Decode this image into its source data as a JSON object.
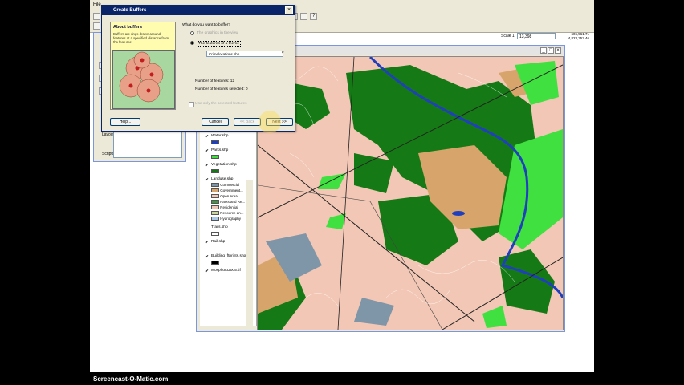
{
  "app": {
    "menu_file": "File"
  },
  "toolbar": {
    "scale_label": "Scale 1:",
    "scale_value": "13,398",
    "coord_x": "606,561.71",
    "coord_y": "4,823,352.46"
  },
  "dialog": {
    "title": "Create Buffers",
    "about_title": "About buffers",
    "about_text": "Buffers are rings drawn around features at a specified distance from the features.",
    "question": "What do you want to buffer?",
    "option_graphics": "The graphics in the view",
    "option_features": "The features of a theme",
    "theme_selected": "Crimelocations.shp",
    "num_features": "Number of features:  12",
    "num_selected": "Number of features selected:  0",
    "only_selected": "Use only the selected features",
    "help_button": "Help...",
    "cancel_button": "Cancel",
    "back_button": "<< Back",
    "next_button": "Next >>"
  },
  "project": {
    "tab_layouts": "Layouts",
    "tab_scripts": "Scripts"
  },
  "toc": {
    "layers": [
      {
        "name": "Water.shp",
        "color": "#1f3fbf"
      },
      {
        "name": "Parks.shp",
        "color": "#3fe03f"
      },
      {
        "name": "Vegetation.shp",
        "color": "#157a15"
      },
      {
        "name": "Landuse.shp",
        "color": ""
      },
      {
        "name": "Trails.shp",
        "color": "#ffffff"
      },
      {
        "name": "Rail.shp",
        "color": ""
      },
      {
        "name": "Building_ftprints.shp",
        "color": "#000000"
      },
      {
        "name": "Mosphoto2005.tif",
        "color": ""
      }
    ],
    "landuse_classes": [
      {
        "name": "Commercial",
        "color": "#7f95a8"
      },
      {
        "name": "Government...",
        "color": "#d7a56b"
      },
      {
        "name": "Open Area",
        "color": "#f2c7b5"
      },
      {
        "name": "Parks and Re...",
        "color": "#3f9a3f"
      },
      {
        "name": "Residential",
        "color": "#f2c7b5"
      },
      {
        "name": "Resource an...",
        "color": "#c8d6a0"
      },
      {
        "name": "Hydrography",
        "color": "#a7c7e7"
      }
    ]
  },
  "caption": "Screencast-O-Matic.com"
}
